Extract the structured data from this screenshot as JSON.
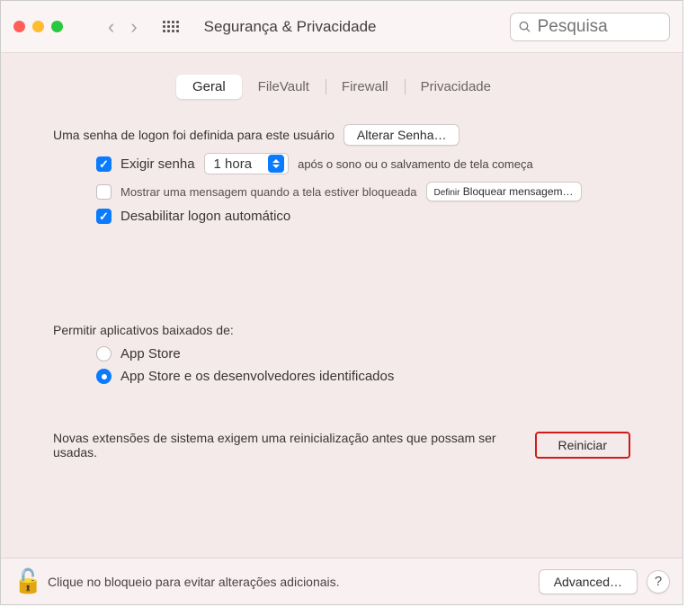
{
  "toolbar": {
    "title": "Segurança &amp; Privacidade",
    "search_placeholder": "Pesquisa"
  },
  "tabs": {
    "general": "Geral",
    "filevault": "FileVault",
    "firewall": "Firewall",
    "privacy": "Privacidade"
  },
  "login": {
    "password_set_text": "Uma senha de logon foi definida para este usuário",
    "change_password_btn": "Alterar Senha…",
    "require_password_prefix": "Exigir senha",
    "require_password_select": "1 hora",
    "require_password_suffix": "após o sono ou o salvamento de tela começa",
    "show_message_label": "Mostrar uma mensagem quando a tela estiver bloqueada",
    "set_lock_message_prefix": "Definir",
    "set_lock_message_btn": "Bloquear mensagem…",
    "disable_autologin": "Desabilitar logon automático"
  },
  "downloads": {
    "header": "Permitir aplicativos baixados de:",
    "appstore": "App Store",
    "appstore_dev": "App Store e os desenvolvedores identificados"
  },
  "extensions": {
    "text": "Novas extensões de sistema exigem uma reinicialização antes que possam ser usadas.",
    "restart_btn": "Reiniciar"
  },
  "footer": {
    "lock_text": "Clique no bloqueio para evitar alterações adicionais.",
    "advanced_btn": "Advanced…"
  }
}
